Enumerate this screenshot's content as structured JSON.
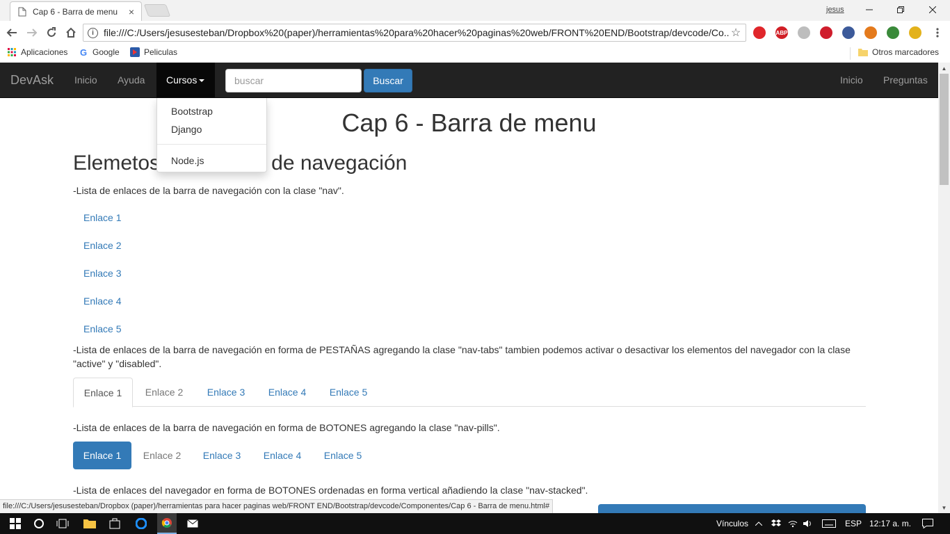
{
  "browser": {
    "tab_title": "Cap 6 - Barra de menu",
    "tab_close": "×",
    "user": "jesus",
    "url": "file:///C:/Users/jesusesteban/Dropbox%20(paper)/herramientas%20para%20hacer%20paginas%20web/FRONT%20END/Bootstrap/devcode/Co...",
    "info_glyph": "i",
    "star_glyph": "☆",
    "status_url": "file:///C:/Users/jesusesteban/Dropbox (paper)/herramientas para hacer paginas web/FRONT END/Bootstrap/devcode/Componentes/Cap 6 - Barra de menu.html#",
    "extensions": [
      {
        "label": "",
        "color": "#e0262b"
      },
      {
        "label": "ABP",
        "color": "#d11f26"
      },
      {
        "label": "",
        "color": "#bdbdbd"
      },
      {
        "label": "",
        "color": "#cf1d2c"
      },
      {
        "label": "",
        "color": "#3c5a9a"
      },
      {
        "label": "",
        "color": "#e47a1c"
      },
      {
        "label": "",
        "color": "#3a8a3a"
      },
      {
        "label": "",
        "color": "#e3b21b"
      }
    ]
  },
  "bookmarks": {
    "apps": "Aplicaciones",
    "google": "Google",
    "google_glyph": "G",
    "peliculas": "Peliculas",
    "otros": "Otros marcadores"
  },
  "navbar": {
    "brand": "DevAsk",
    "inicio": "Inicio",
    "ayuda": "Ayuda",
    "cursos": "Cursos",
    "search_placeholder": "buscar",
    "search_button": "Buscar",
    "right_inicio": "Inicio",
    "right_preguntas": "Preguntas"
  },
  "dropdown": {
    "items": [
      "Bootstrap",
      "Django",
      "Node.js"
    ]
  },
  "content": {
    "h1": "Cap 6 - Barra de menu",
    "h2": "Elemetos de la barra de navegación",
    "p1": "-Lista de enlaces de la barra de navegación con la clase \"nav\".",
    "links": [
      "Enlace 1",
      "Enlace 2",
      "Enlace 3",
      "Enlace 4",
      "Enlace 5"
    ],
    "p2": "-Lista de enlaces de la barra de navegación en forma de PESTAÑAS agregando la clase \"nav-tabs\" tambien podemos activar o desactivar los elementos del navegador con la clase \"active\" y \"disabled\".",
    "tabs": [
      "Enlace 1",
      "Enlace 2",
      "Enlace 3",
      "Enlace 4",
      "Enlace 5"
    ],
    "p3": "-Lista de enlaces de la barra de navegación en forma de BOTONES agregando la clase \"nav-pills\".",
    "pills": [
      "Enlace 1",
      "Enlace 2",
      "Enlace 3",
      "Enlace 4",
      "Enlace 5"
    ],
    "p4": "-Lista de enlaces del navegador en forma de BOTONES ordenadas en forma vertical añadiendo la clase \"nav-stacked\"."
  },
  "taskbar": {
    "vinculos": "Vínculos",
    "lang": "ESP",
    "time": "12:17 a. m."
  },
  "colors": {
    "primary": "#337ab7",
    "navbar_bg": "#222222",
    "navbar_active": "#080808"
  }
}
